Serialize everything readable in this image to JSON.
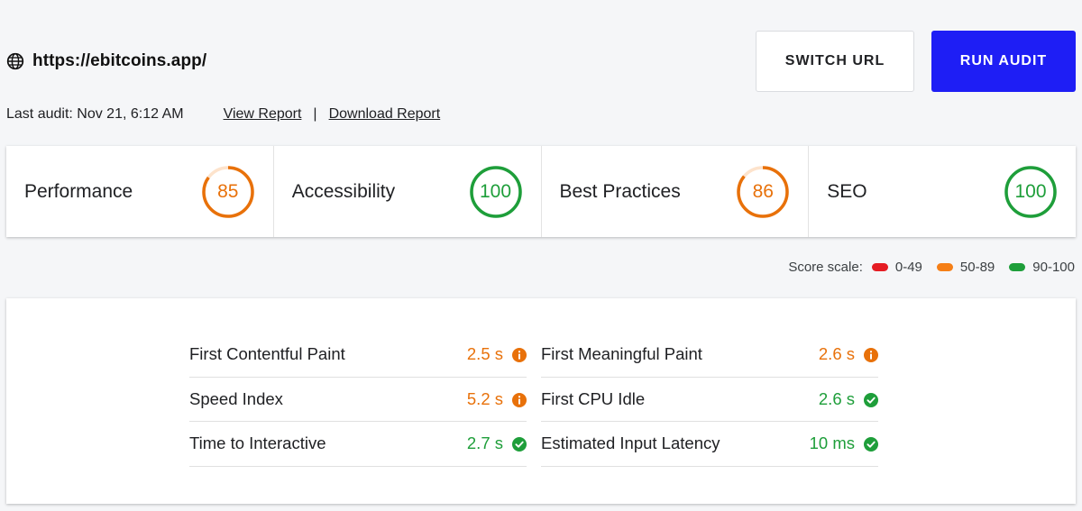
{
  "header": {
    "url": "https://ebitcoins.app/",
    "switch_label": "SWITCH URL",
    "run_label": "RUN AUDIT",
    "last_audit": "Last audit: Nov 21, 6:12 AM",
    "view_report": "View Report",
    "separator": "|",
    "download_report": "Download Report"
  },
  "scores": [
    {
      "label": "Performance",
      "score": "85",
      "value": 85,
      "status": "average"
    },
    {
      "label": "Accessibility",
      "score": "100",
      "value": 100,
      "status": "pass"
    },
    {
      "label": "Best Practices",
      "score": "86",
      "value": 86,
      "status": "average"
    },
    {
      "label": "SEO",
      "score": "100",
      "value": 100,
      "status": "pass"
    }
  ],
  "legend": {
    "title": "Score scale:",
    "ranges": [
      {
        "label": "0-49",
        "color": "#e51c23"
      },
      {
        "label": "50-89",
        "color": "#f57f17"
      },
      {
        "label": "90-100",
        "color": "#1e9e3a"
      }
    ]
  },
  "metrics": {
    "left": [
      {
        "name": "First Contentful Paint",
        "value": "2.5 s",
        "status": "average"
      },
      {
        "name": "Speed Index",
        "value": "5.2 s",
        "status": "average"
      },
      {
        "name": "Time to Interactive",
        "value": "2.7 s",
        "status": "pass"
      }
    ],
    "right": [
      {
        "name": "First Meaningful Paint",
        "value": "2.6 s",
        "status": "average"
      },
      {
        "name": "First CPU Idle",
        "value": "2.6 s",
        "status": "pass"
      },
      {
        "name": "Estimated Input Latency",
        "value": "10 ms",
        "status": "pass"
      }
    ]
  },
  "colors": {
    "average": "#e8710a",
    "pass": "#1e9e3a",
    "accent": "#1e1ef5"
  }
}
